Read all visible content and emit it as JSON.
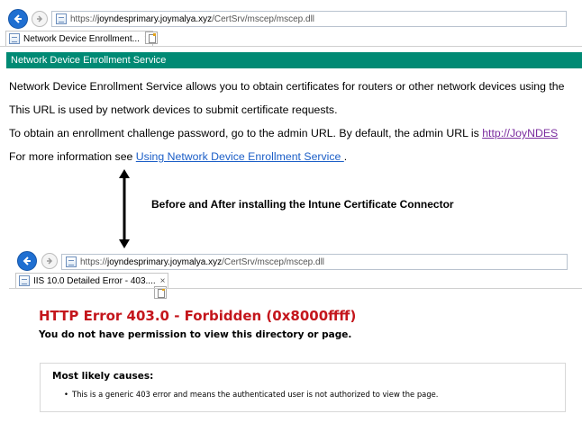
{
  "before": {
    "address": {
      "prefix": "https://",
      "host": "joyndesprimary.joymalya.xyz",
      "path": "/CertSrv/mscep/mscep.dll"
    },
    "tab": {
      "title": "Network Device Enrollment...",
      "close": "×"
    },
    "page": {
      "header": "Network Device Enrollment Service",
      "p1": "Network Device Enrollment Service allows you to obtain certificates for routers or other network devices using the",
      "p2": "This URL is used by network devices to submit certificate requests.",
      "p3_text": "To obtain an enrollment challenge password, go to the admin URL. By default, the admin URL is ",
      "p3_link": "http://JoyNDES",
      "p4_text": "For more information see ",
      "p4_link": "Using Network Device Enrollment Service ",
      "p4_end": "."
    }
  },
  "annotation": "Before and After installing the Intune Certificate Connector",
  "after": {
    "address": {
      "prefix": "https://",
      "host": "joyndesprimary.joymalya.xyz",
      "path": "/CertSrv/mscep/mscep.dll"
    },
    "tab": {
      "title": "IIS 10.0 Detailed Error - 403....",
      "close": "×"
    },
    "error": {
      "title": "HTTP Error 403.0 - Forbidden (0x8000ffff)",
      "subtitle": "You do not have permission to view this directory or page.",
      "causes_heading": "Most likely causes:",
      "causes": [
        "This is a generic 403 error and means the authenticated user is not authorized to view the page."
      ]
    }
  },
  "colors": {
    "ndes_bar": "#008a74",
    "error_title": "#c4161c",
    "back_button": "#1f6fd1",
    "link": "#1b5ec7",
    "visited_link": "#7a2b9e"
  }
}
